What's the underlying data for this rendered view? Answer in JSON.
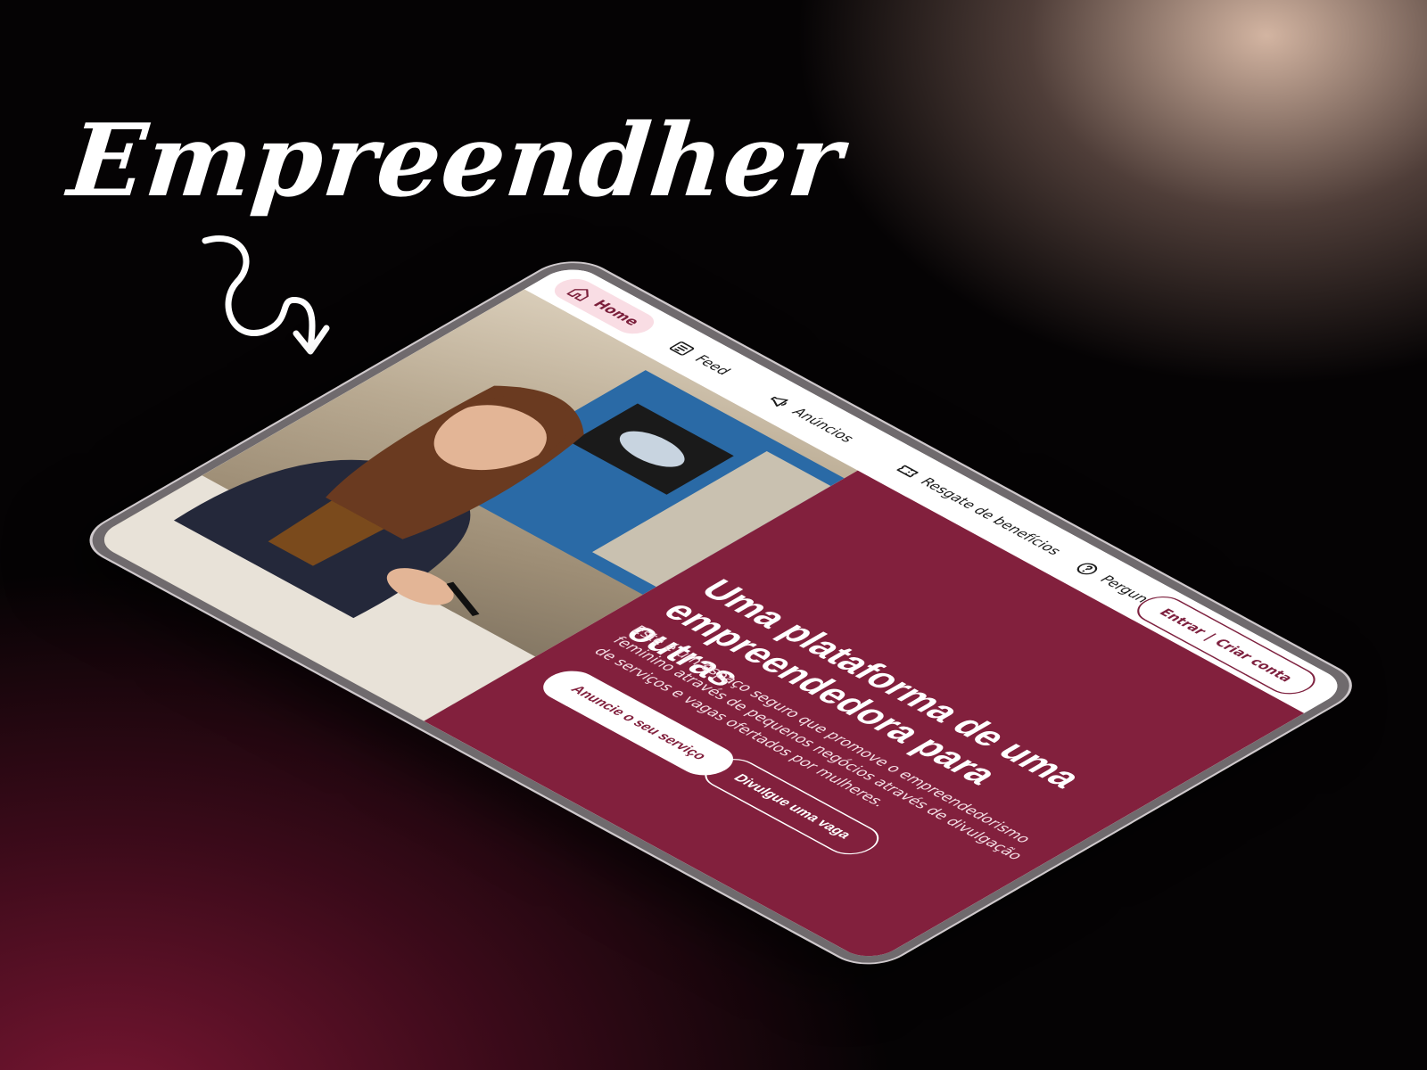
{
  "brand": {
    "title": "Empreendher"
  },
  "nav": {
    "items": [
      {
        "label": "Home",
        "icon": "home-icon",
        "active": true
      },
      {
        "label": "Feed",
        "icon": "feed-icon"
      },
      {
        "label": "Anúncios",
        "icon": "megaphone-icon"
      },
      {
        "label": "Resgate de benefícios",
        "icon": "ticket-icon"
      },
      {
        "label": "Perguntas frequentes",
        "icon": "question-icon"
      }
    ],
    "login_label": "Entrar",
    "divider": "|",
    "signup_label": "Criar conta"
  },
  "hero": {
    "title": "Uma plataforma de uma empreendedora para outras",
    "description": "Este é um espaço seguro que promove o empreendedorismo feminino através de pequenos negócios através de divulgação de serviços e vagas ofertados por mulheres.",
    "primary_cta": "Anuncie o seu serviço",
    "secondary_cta": "Divulgue uma vaga"
  },
  "colors": {
    "accent": "#82203d",
    "active_pill": "#f9dde4"
  }
}
